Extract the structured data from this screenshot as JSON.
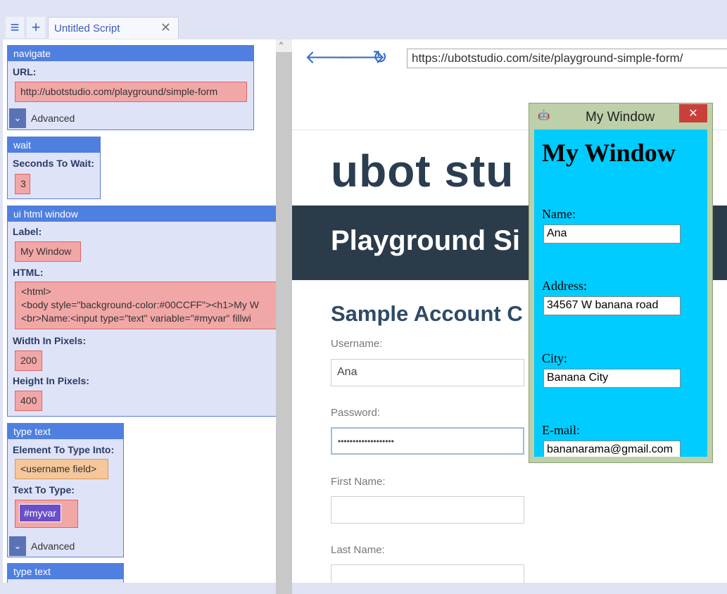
{
  "tabs": {
    "menu_icon": "hamburger-icon",
    "add_icon": "plus-icon",
    "title": "Untitled Script",
    "close": "✕"
  },
  "commands": {
    "navigate": {
      "header": "navigate",
      "url_label": "URL:",
      "url": "http://ubotstudio.com/playground/simple-form",
      "advanced": "Advanced"
    },
    "wait": {
      "header": "wait",
      "seconds_label": "Seconds To Wait:",
      "seconds": "3"
    },
    "ui_html": {
      "header": "ui html window",
      "label_label": "Label:",
      "label": "My Window",
      "html_label": "HTML:",
      "html_lines": [
        "<html>",
        "<body style=\"background-color:#00CCFF\"><h1>My W",
        "<br>Name:<input type=\"text\" variable=\"#myvar\" fillwi"
      ],
      "width_label": "Width In Pixels:",
      "width": "200",
      "height_label": "Height In Pixels:",
      "height": "400"
    },
    "type_text": {
      "header": "type text",
      "element_label": "Element To Type Into:",
      "element": "<username field>",
      "text_label": "Text To Type:",
      "text": "#myvar",
      "advanced": "Advanced"
    },
    "type_text2": {
      "header": "type text"
    }
  },
  "browser": {
    "url": "https://ubotstudio.com/site/playground-simple-form/",
    "logo": "ubot stu",
    "banner": "Playground Si",
    "section": "Sample Account C",
    "fields": [
      {
        "label": "Username:",
        "value": "Ana"
      },
      {
        "label": "Password:",
        "value": "•••••••••••••••••••"
      },
      {
        "label": "First Name:",
        "value": ""
      },
      {
        "label": "Last Name:",
        "value": ""
      }
    ]
  },
  "popup": {
    "title": "My Window",
    "close": "✕",
    "heading": "My Window",
    "fields": [
      {
        "label": "Name:",
        "value": "Ana"
      },
      {
        "label": "Address:",
        "value": "34567 W banana road"
      },
      {
        "label": "City:",
        "value": "Banana City"
      },
      {
        "label": "E-mail:",
        "value": "bananarama@gmail.com"
      }
    ]
  }
}
